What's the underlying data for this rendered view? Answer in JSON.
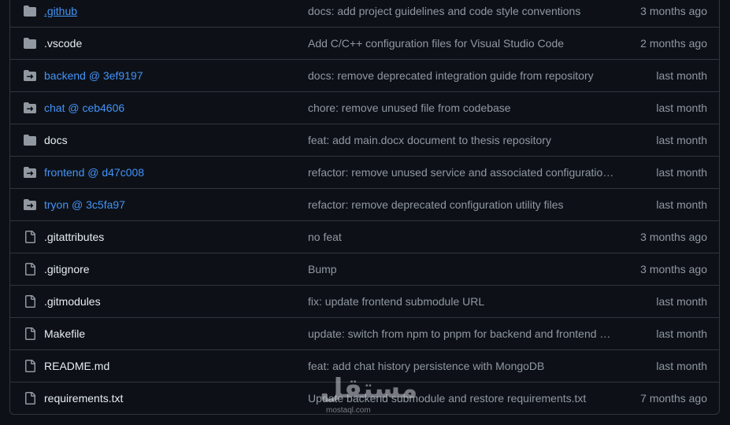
{
  "files": [
    {
      "type": "folder",
      "name": ".github",
      "link": true,
      "underline": true,
      "message": "docs: add project guidelines and code style conventions",
      "age": "3 months ago"
    },
    {
      "type": "folder",
      "name": ".vscode",
      "link": false,
      "underline": false,
      "message": "Add C/C++ configuration files for Visual Studio Code",
      "age": "2 months ago"
    },
    {
      "type": "submodule",
      "name": "backend @ 3ef9197",
      "link": true,
      "underline": false,
      "message": "docs: remove deprecated integration guide from repository",
      "age": "last month"
    },
    {
      "type": "submodule",
      "name": "chat @ ceb4606",
      "link": true,
      "underline": false,
      "message": "chore: remove unused file from codebase",
      "age": "last month"
    },
    {
      "type": "folder",
      "name": "docs",
      "link": false,
      "underline": false,
      "message": "feat: add main.docx document to thesis repository",
      "age": "last month"
    },
    {
      "type": "submodule",
      "name": "frontend @ d47c008",
      "link": true,
      "underline": false,
      "message": "refactor: remove unused service and associated configuration…",
      "age": "last month"
    },
    {
      "type": "submodule",
      "name": "tryon @ 3c5fa97",
      "link": true,
      "underline": false,
      "message": "refactor: remove deprecated configuration utility files",
      "age": "last month"
    },
    {
      "type": "file",
      "name": ".gitattributes",
      "link": false,
      "underline": false,
      "message": "no feat",
      "age": "3 months ago"
    },
    {
      "type": "file",
      "name": ".gitignore",
      "link": false,
      "underline": false,
      "message": "Bump",
      "age": "3 months ago"
    },
    {
      "type": "file",
      "name": ".gitmodules",
      "link": false,
      "underline": false,
      "message": "fix: update frontend submodule URL",
      "age": "last month"
    },
    {
      "type": "file",
      "name": "Makefile",
      "link": false,
      "underline": false,
      "message": "update: switch from npm to pnpm for backend and frontend …",
      "age": "last month"
    },
    {
      "type": "file",
      "name": "README.md",
      "link": false,
      "underline": false,
      "message": "feat: add chat history persistence with MongoDB",
      "age": "last month"
    },
    {
      "type": "file",
      "name": "requirements.txt",
      "link": false,
      "underline": false,
      "message": "Update backend submodule and restore requirements.txt",
      "age": "7 months ago"
    }
  ],
  "watermark": {
    "logo_text": "مستقل",
    "sub_text": "mostaql.com"
  },
  "colors": {
    "link": "#4493f8",
    "text": "#e6edf3",
    "muted": "#9198a1",
    "icon": "#9198a1",
    "border": "#30363d",
    "background": "#0d1117"
  }
}
